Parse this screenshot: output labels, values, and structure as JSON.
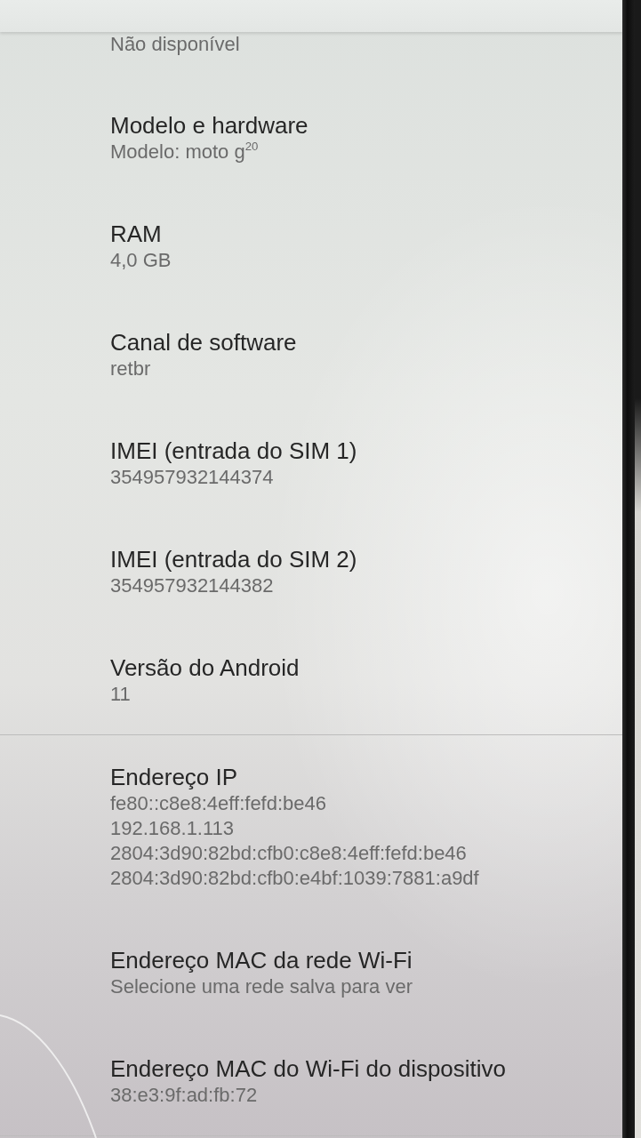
{
  "sections": [
    {
      "items": [
        {
          "summary": [
            "Não disponível"
          ]
        },
        {
          "title": "Modelo e hardware",
          "summary": [
            "Modelo: moto g$^{20}$"
          ]
        },
        {
          "title": "RAM",
          "summary": [
            "4,0 GB"
          ]
        },
        {
          "title": "Canal de software",
          "summary": [
            "retbr"
          ]
        },
        {
          "title": "IMEI (entrada do SIM 1)",
          "summary": [
            "354957932144374"
          ]
        },
        {
          "title": "IMEI (entrada do SIM 2)",
          "summary": [
            "354957932144382"
          ]
        },
        {
          "title": "Versão do Android",
          "summary": [
            "11"
          ]
        }
      ]
    },
    {
      "items": [
        {
          "title": "Endereço IP",
          "summary": [
            "fe80::c8e8:4eff:fefd:be46",
            "192.168.1.113",
            "2804:3d90:82bd:cfb0:c8e8:4eff:fefd:be46",
            "2804:3d90:82bd:cfb0:e4bf:1039:7881:a9df"
          ]
        },
        {
          "title": "Endereço MAC da rede Wi-Fi",
          "summary": [
            "Selecione uma rede salva para ver"
          ]
        },
        {
          "title": "Endereço MAC do Wi-Fi do dispositivo",
          "summary": [
            "38:e3:9f:ad:fb:72"
          ]
        }
      ]
    }
  ]
}
